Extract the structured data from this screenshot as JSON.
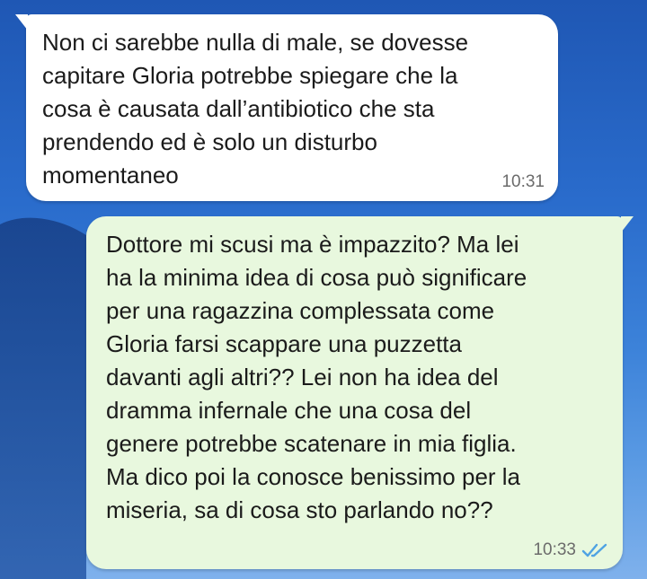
{
  "chat": {
    "messages": [
      {
        "direction": "incoming",
        "text": "Non ci sarebbe nulla di male, se dovesse\ncapitare Gloria potrebbe spiegare che la\ncosa è causata dall’antibiotico che sta\nprendendo ed è solo un disturbo\nmomentaneo",
        "time": "10:31"
      },
      {
        "direction": "outgoing",
        "text": "Dottore mi scusi ma è impazzito? Ma lei\nha la minima idea di cosa può significare\nper una ragazzina complessata come\nGloria farsi scappare una puzzetta\ndavanti agli altri?? Lei non ha idea del\ndramma infernale che una cosa del\ngenere potrebbe scatenare in mia figlia.\nMa dico poi la conosce benissimo per la\nmiseria, sa di cosa sto parlando no??",
        "time": "10:33",
        "status_icon": "double-check-read-icon"
      }
    ]
  },
  "colors": {
    "incoming_bubble": "#ffffff",
    "outgoing_bubble": "#e8f8de",
    "read_ticks": "#4fa3e3",
    "timestamp": "#6b6b6b",
    "message_text": "#1b1b1b"
  }
}
